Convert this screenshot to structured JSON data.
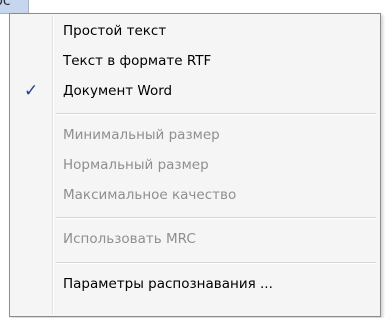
{
  "anchor": {
    "label": "рс"
  },
  "menu": {
    "check_glyph": "✓",
    "items": [
      {
        "label": "Простой текст",
        "enabled": true,
        "checked": false
      },
      {
        "label": "Текст в формате RTF",
        "enabled": true,
        "checked": false
      },
      {
        "label": "Документ Word",
        "enabled": true,
        "checked": true
      },
      {
        "label": "Минимальный размер",
        "enabled": false,
        "checked": false
      },
      {
        "label": "Нормальный размер",
        "enabled": false,
        "checked": false
      },
      {
        "label": "Максимальное качество",
        "enabled": false,
        "checked": false
      },
      {
        "label": "Использовать MRC",
        "enabled": false,
        "checked": false
      },
      {
        "label": "Параметры распознавания ...",
        "enabled": true,
        "checked": false
      }
    ]
  },
  "colors": {
    "menu_background": "#f5f5f5",
    "disabled_text": "#8f8f8f",
    "check_mark": "#1f3f8f",
    "anchor_highlight": "#c5d6ee"
  }
}
